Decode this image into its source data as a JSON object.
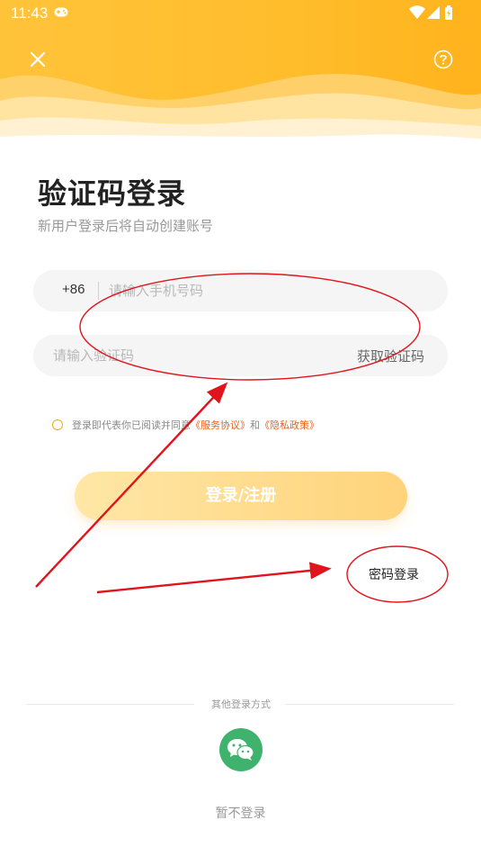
{
  "status_bar": {
    "time": "11:43",
    "icons": [
      "gamepad-icon",
      "wifi-icon",
      "signal-icon",
      "battery-charging-icon"
    ]
  },
  "header": {
    "close_icon": "close-icon",
    "help_icon": "help-icon",
    "gradient_colors": [
      "#ffbe2e",
      "#ffd36b"
    ]
  },
  "main": {
    "title": "验证码登录",
    "subtitle": "新用户登录后将自动创建账号"
  },
  "phone_field": {
    "country_code": "+86",
    "placeholder": "请输入手机号码",
    "value": ""
  },
  "code_field": {
    "placeholder": "请输入验证码",
    "value": "",
    "get_code_label": "获取验证码"
  },
  "agreement": {
    "prefix": "登录即代表你已阅读并同意",
    "service_link": "《服务协议》",
    "and": "和",
    "privacy_link": "《隐私政策》",
    "checked": false
  },
  "login_button": {
    "label": "登录/注册"
  },
  "password_login": {
    "label": "密码登录"
  },
  "other_login": {
    "label": "其他登录方式",
    "methods": [
      "wechat-icon"
    ]
  },
  "skip": {
    "label": "暂不登录"
  },
  "colors": {
    "accent": "#ffbe2e",
    "link": "#e8631a",
    "wechat": "#3fb36d",
    "annotation": "#e0141c"
  }
}
